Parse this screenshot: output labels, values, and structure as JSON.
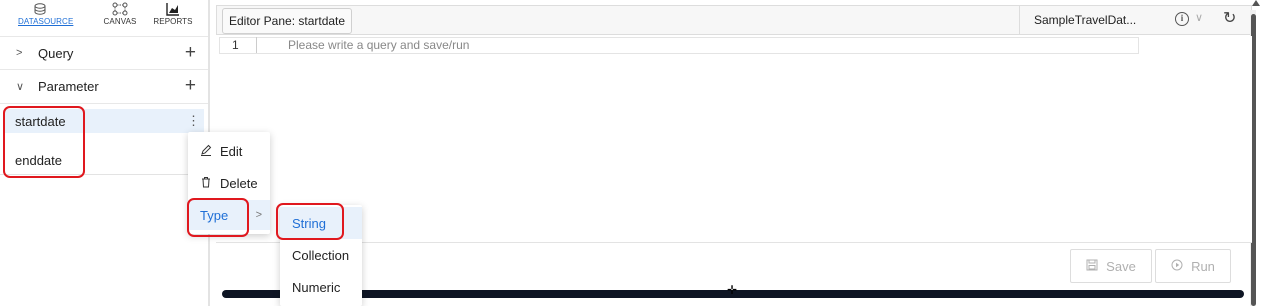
{
  "sidebar": {
    "tabs": [
      {
        "label": "DATASOURCE",
        "icon": "datasource-icon",
        "active": true
      },
      {
        "label": "CANVAS",
        "icon": "canvas-icon",
        "active": false
      },
      {
        "label": "REPORTS",
        "icon": "reports-icon",
        "active": false
      }
    ],
    "query_label": "Query",
    "parameter_label": "Parameter",
    "parameters": [
      "startdate",
      "enddate"
    ]
  },
  "header": {
    "editor_title": "Editor Pane: startdate",
    "datasource": "SampleTravelDat..."
  },
  "editor": {
    "line_number": "1",
    "placeholder": "Please write a query and save/run"
  },
  "footer": {
    "save_label": "Save",
    "run_label": "Run"
  },
  "context_menu": {
    "items": [
      "Edit",
      "Delete",
      "Type"
    ]
  },
  "type_submenu": {
    "items": [
      "String",
      "Collection",
      "Numeric"
    ],
    "selected": "String"
  },
  "colors": {
    "accent": "#1f6fd6",
    "highlight": "#e0181e",
    "selected_bg": "#e8f1fb"
  }
}
